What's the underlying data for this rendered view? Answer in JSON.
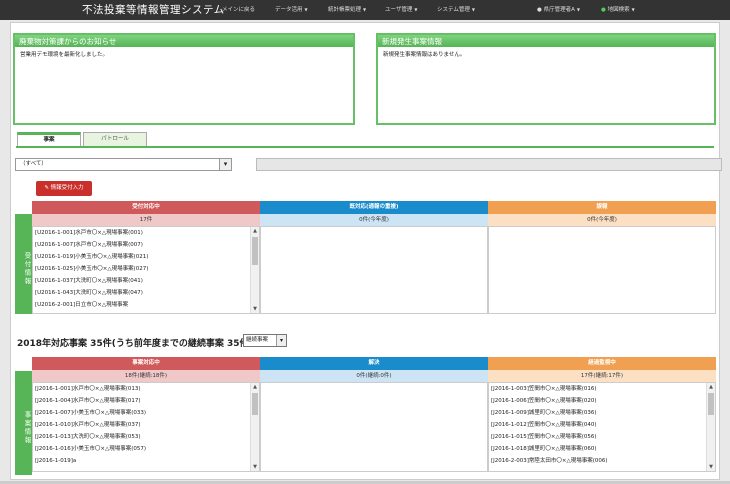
{
  "app_title": "不法投棄等情報管理システム",
  "nav": {
    "back": "メインに戻る",
    "data": "データ活用",
    "stats": "統計帳票処理",
    "users": "ユーザ管理",
    "system": "システム管理",
    "user": "県庁管理者A",
    "map": "地図検索"
  },
  "notices": {
    "left_title": "廃棄物対策課からのお知らせ",
    "left_body": "営業用デモ環境を最新化しました。",
    "right_title": "新規発生事案情報",
    "right_body": "新規発生事案情報はありません。"
  },
  "tabs": [
    "事案",
    "パトロール"
  ],
  "filter_value": "（すべて）",
  "input_button": "情報受付入力",
  "reception": {
    "side_label": "受付情報",
    "headers": [
      "受付対応中",
      "既対応(通報の重複)",
      "誤報"
    ],
    "counts": [
      "17件",
      "0件(今年度)",
      "0件(今年度)"
    ],
    "items": [
      "[U2016-1-001]水戸市〇×△現場事案(001)",
      "[U2016-1-007]水戸市〇×△現場事案(007)",
      "[U2016-1-019]小美玉市〇×△現場事案(021)",
      "[U2016-1-025]小美玉市〇×△現場事案(027)",
      "[U2016-1-037]大洗町〇×△現場事案(041)",
      "[U2016-1-043]大洗町〇×△現場事案(047)",
      "[U2016-2-001]日立市〇×△現場事案"
    ]
  },
  "cases": {
    "year_title": "2018年対応事案 35件(うち前年度までの継続事案 35件)",
    "year_select": "継続事案",
    "side_label": "事案情報",
    "headers": [
      "事案対応中",
      "解決",
      "経過監視中"
    ],
    "counts": [
      "18件(継続:18件)",
      "0件(継続:0件)",
      "17件(継続:17件)"
    ],
    "col1": [
      "[J2016-1-001]水戸市〇×△現場事案(013)",
      "[J2016-1-004]水戸市〇×△現場事案(017)",
      "[J2016-1-007]小美玉市〇×△現場事案(033)",
      "[J2016-1-010]水戸市〇×△現場事案(037)",
      "[J2016-1-013]大洗町〇×△現場事案(053)",
      "[J2016-1-016]小美玉市〇×△現場事案(057)",
      "[J2016-1-019]a"
    ],
    "col3": [
      "[J2016-1-003]笠間市〇×△現場事案(016)",
      "[J2016-1-006]笠間市〇×△現場事案(020)",
      "[J2016-1-009]城里町〇×△現場事案(036)",
      "[J2016-1-012]笠間市〇×△現場事案(040)",
      "[J2016-1-015]笠間市〇×△現場事案(056)",
      "[J2016-1-018]城里町〇×△現場事案(060)",
      "[J2016-2-003]常陸太田市〇×△現場事案(006)"
    ]
  },
  "colors": {
    "red": "#d0595b",
    "blue": "#1a8ccc",
    "orange": "#f0a050",
    "green": "#57b457"
  }
}
